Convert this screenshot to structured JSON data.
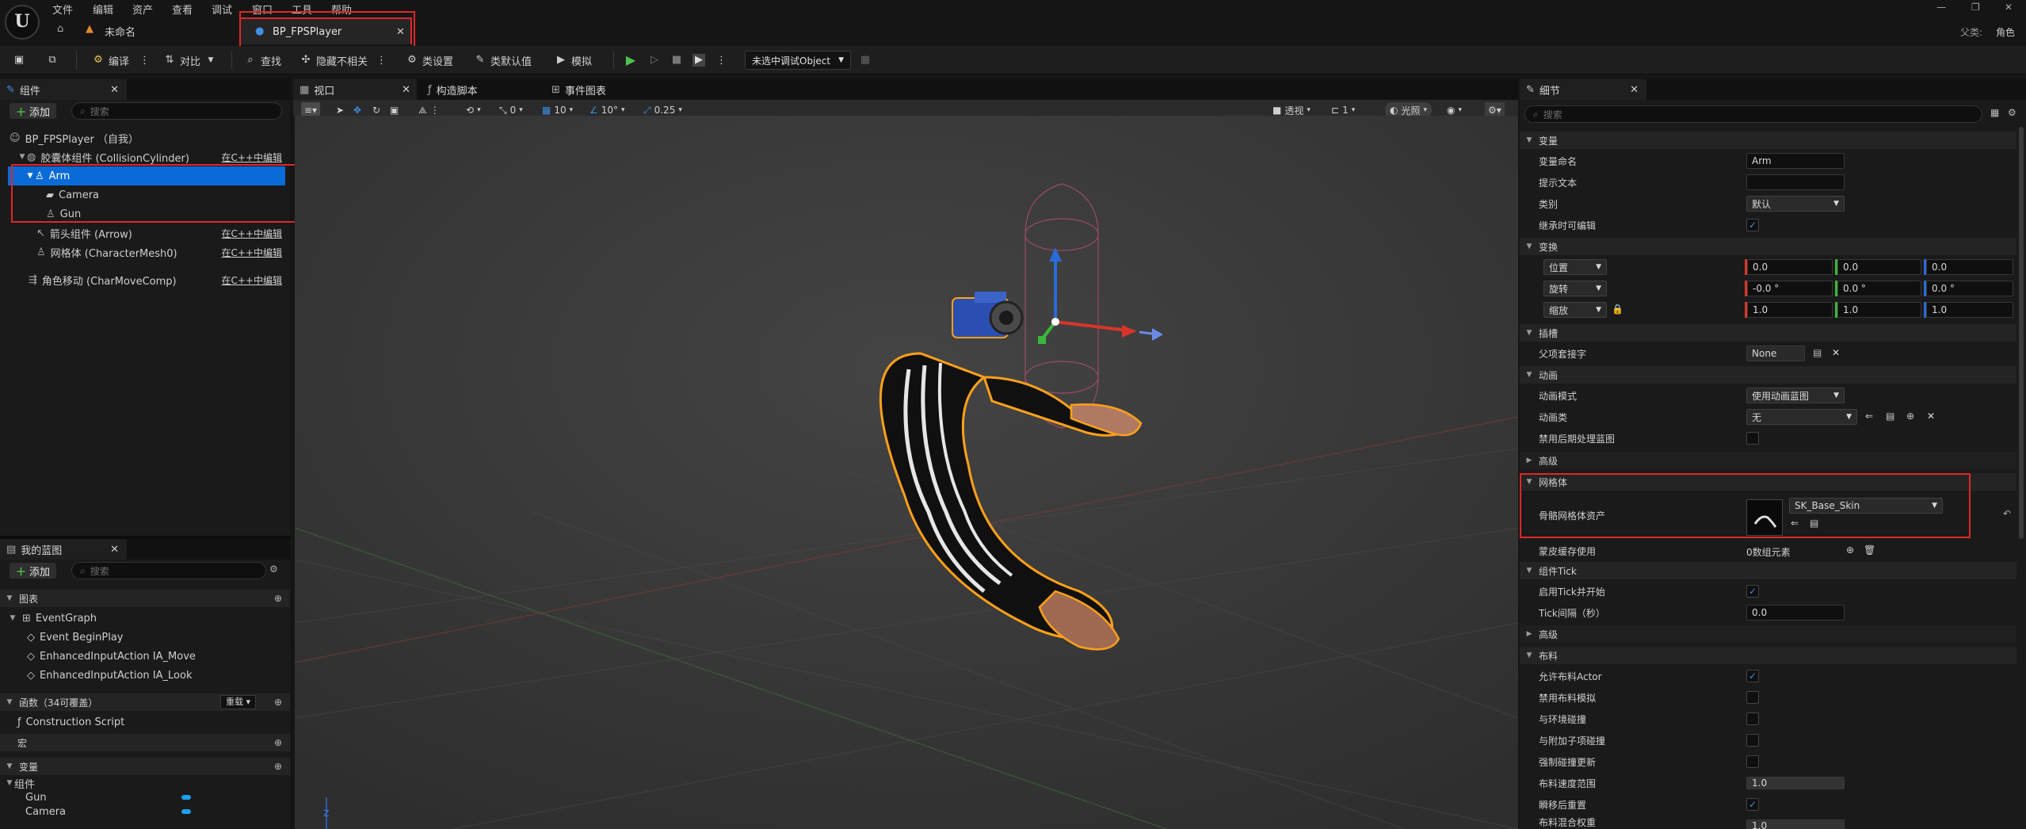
{
  "menu": [
    "文件",
    "编辑",
    "资产",
    "查看",
    "调试",
    "窗口",
    "工具",
    "帮助"
  ],
  "tabs": {
    "home_tab": "未命名",
    "doc_tab": "BP_FPSPlayer",
    "parent_label": "父类:",
    "parent_value": "角色"
  },
  "toolbar": {
    "compile": "编译",
    "diff": "对比",
    "find": "查找",
    "hide_unrelated": "隐藏不相关",
    "class_settings": "类设置",
    "class_defaults": "类默认值",
    "simulate": "模拟",
    "debug_object": "未选中调试Object"
  },
  "components_panel": {
    "tab": "组件",
    "add": "添加",
    "search_placeholder": "搜索",
    "root": "BP_FPSPlayer （自我）",
    "items": [
      {
        "label": "胶囊体组件 (CollisionCylinder)",
        "link": "在C++中编辑"
      },
      {
        "label": "Arm",
        "link": ""
      },
      {
        "label": "Camera",
        "link": ""
      },
      {
        "label": "Gun",
        "link": ""
      },
      {
        "label": "箭头组件 (Arrow)",
        "link": "在C++中编辑"
      },
      {
        "label": "网格体 (CharacterMesh0)",
        "link": "在C++中编辑"
      },
      {
        "label": "角色移动 (CharMoveComp)",
        "link": "在C++中编辑"
      }
    ]
  },
  "blueprint_panel": {
    "tab": "我的蓝图",
    "add": "添加",
    "search_placeholder": "搜索",
    "graphs_header": "图表",
    "graphs": [
      "EventGraph",
      "Event BeginPlay",
      "EnhancedInputAction IA_Move",
      "EnhancedInputAction IA_Look"
    ],
    "functions_header": "函数（34可覆盖）",
    "override_label": "重载",
    "functions": [
      "Construction Script"
    ],
    "macros_header": "宏",
    "variables_header": "变量",
    "var_group": "组件",
    "variables": [
      "Gun",
      "Camera"
    ]
  },
  "center_tabs": {
    "viewport": "视口",
    "construction": "构造脚本",
    "event_graph": "事件图表"
  },
  "viewport_toolbar": {
    "rot_snap": "0",
    "grid_snap": "10",
    "angle_snap": "10°",
    "scale_snap": "0.25",
    "perspective": "透视",
    "cam_speed": "1",
    "lit": "光照"
  },
  "details": {
    "tab": "细节",
    "search_placeholder": "搜索",
    "sections": {
      "variable": "变量",
      "transform": "变换",
      "sockets": "插槽",
      "animation": "动画",
      "advanced": "高级",
      "mesh": "网格体",
      "component_tick": "组件Tick",
      "advanced2": "高级",
      "cloth": "布料"
    },
    "variable_name_label": "变量命名",
    "variable_name": "Arm",
    "tooltip_label": "提示文本",
    "tooltip_value": "",
    "category_label": "类别",
    "category_value": "默认",
    "editable_label": "继承时可编辑",
    "location_label": "位置",
    "location": [
      "0.0",
      "0.0",
      "0.0"
    ],
    "rotation_label": "旋转",
    "rotation": [
      "-0.0 °",
      "0.0 °",
      "0.0 °"
    ],
    "scale_label": "缩放",
    "scale": [
      "1.0",
      "1.0",
      "1.0"
    ],
    "parent_socket_label": "父项套接字",
    "parent_socket": "None",
    "anim_mode_label": "动画模式",
    "anim_mode": "使用动画蓝图",
    "anim_class_label": "动画类",
    "anim_class": "无",
    "disable_post_label": "禁用后期处理蓝图",
    "skel_mesh_label": "骨骼网格体资产",
    "skel_mesh": "SK_Base_Skin",
    "skin_cache_label": "蒙皮缓存使用",
    "skin_cache_value": "0数组元素",
    "tick_start_label": "启用Tick并开始",
    "tick_interval_label": "Tick间隔（秒）",
    "tick_interval": "0.0",
    "allow_cloth_label": "允许布料Actor",
    "disable_cloth_label": "禁用布料模拟",
    "env_collide_label": "与环境碰撞",
    "attach_collide_label": "与附加子项碰撞",
    "force_collide_label": "强制碰撞更新",
    "cloth_vel_label": "布料速度范围",
    "cloth_vel": "1.0",
    "teleport_reset_label": "瞬移后重置",
    "cloth_blend_label": "布料混合权重",
    "cloth_blend": "1.0"
  },
  "colors": {
    "accent": "#0a6bd6",
    "highlight": "#e0262a",
    "outline": "#ffa01a"
  }
}
